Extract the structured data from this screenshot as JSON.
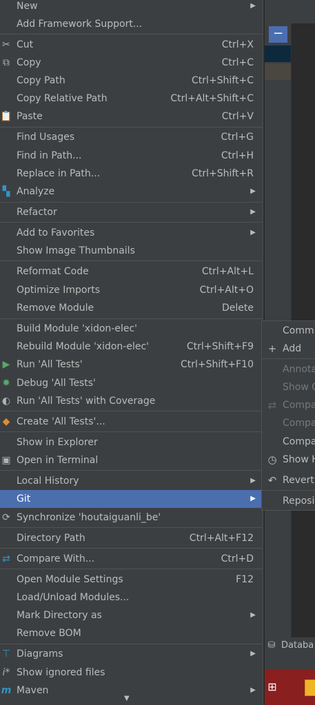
{
  "context_menu": {
    "items": [
      {
        "label": "New",
        "shortcut": "",
        "submenu": true,
        "icon": ""
      },
      {
        "label": "Add Framework Support...",
        "shortcut": "",
        "submenu": false,
        "icon": ""
      },
      {
        "label": "Cut",
        "shortcut": "Ctrl+X",
        "submenu": false,
        "icon": "scissors-icon"
      },
      {
        "label": "Copy",
        "shortcut": "Ctrl+C",
        "submenu": false,
        "icon": "copy-icon"
      },
      {
        "label": "Copy Path",
        "shortcut": "Ctrl+Shift+C",
        "submenu": false,
        "icon": ""
      },
      {
        "label": "Copy Relative Path",
        "shortcut": "Ctrl+Alt+Shift+C",
        "submenu": false,
        "icon": ""
      },
      {
        "label": "Paste",
        "shortcut": "Ctrl+V",
        "submenu": false,
        "icon": "clipboard-icon"
      },
      {
        "label": "Find Usages",
        "shortcut": "Ctrl+G",
        "submenu": false,
        "icon": ""
      },
      {
        "label": "Find in Path...",
        "shortcut": "Ctrl+H",
        "submenu": false,
        "icon": ""
      },
      {
        "label": "Replace in Path...",
        "shortcut": "Ctrl+Shift+R",
        "submenu": false,
        "icon": ""
      },
      {
        "label": "Analyze",
        "shortcut": "",
        "submenu": true,
        "icon": "analyze-icon"
      },
      {
        "label": "Refactor",
        "shortcut": "",
        "submenu": true,
        "icon": ""
      },
      {
        "label": "Add to Favorites",
        "shortcut": "",
        "submenu": true,
        "icon": ""
      },
      {
        "label": "Show Image Thumbnails",
        "shortcut": "",
        "submenu": false,
        "icon": ""
      },
      {
        "label": "Reformat Code",
        "shortcut": "Ctrl+Alt+L",
        "submenu": false,
        "icon": ""
      },
      {
        "label": "Optimize Imports",
        "shortcut": "Ctrl+Alt+O",
        "submenu": false,
        "icon": ""
      },
      {
        "label": "Remove Module",
        "shortcut": "Delete",
        "submenu": false,
        "icon": ""
      },
      {
        "label": "Build Module 'xidon-elec'",
        "shortcut": "",
        "submenu": false,
        "icon": ""
      },
      {
        "label": "Rebuild Module 'xidon-elec'",
        "shortcut": "Ctrl+Shift+F9",
        "submenu": false,
        "icon": ""
      },
      {
        "label": "Run 'All Tests'",
        "shortcut": "Ctrl+Shift+F10",
        "submenu": false,
        "icon": "run-icon"
      },
      {
        "label": "Debug 'All Tests'",
        "shortcut": "",
        "submenu": false,
        "icon": "debug-icon"
      },
      {
        "label": "Run 'All Tests' with Coverage",
        "shortcut": "",
        "submenu": false,
        "icon": "coverage-icon"
      },
      {
        "label": "Create 'All Tests'...",
        "shortcut": "",
        "submenu": false,
        "icon": "create-test-icon"
      },
      {
        "label": "Show in Explorer",
        "shortcut": "",
        "submenu": false,
        "icon": ""
      },
      {
        "label": "Open in Terminal",
        "shortcut": "",
        "submenu": false,
        "icon": "terminal-icon"
      },
      {
        "label": "Local History",
        "shortcut": "",
        "submenu": true,
        "icon": ""
      },
      {
        "label": "Git",
        "shortcut": "",
        "submenu": true,
        "icon": "",
        "selected": true
      },
      {
        "label": "Synchronize 'houtaiguanli_be'",
        "shortcut": "",
        "submenu": false,
        "icon": "sync-icon"
      },
      {
        "label": "Directory Path",
        "shortcut": "Ctrl+Alt+F12",
        "submenu": false,
        "icon": ""
      },
      {
        "label": "Compare With...",
        "shortcut": "Ctrl+D",
        "submenu": false,
        "icon": "compare-icon"
      },
      {
        "label": "Open Module Settings",
        "shortcut": "F12",
        "submenu": false,
        "icon": ""
      },
      {
        "label": "Load/Unload Modules...",
        "shortcut": "",
        "submenu": false,
        "icon": ""
      },
      {
        "label": "Mark Directory as",
        "shortcut": "",
        "submenu": true,
        "icon": ""
      },
      {
        "label": "Remove BOM",
        "shortcut": "",
        "submenu": false,
        "icon": ""
      },
      {
        "label": "Diagrams",
        "shortcut": "",
        "submenu": true,
        "icon": "diagrams-icon"
      },
      {
        "label": "Show ignored files",
        "shortcut": "",
        "submenu": false,
        "icon": "ignored-files-icon"
      },
      {
        "label": "Maven",
        "shortcut": "",
        "submenu": true,
        "icon": "maven-icon"
      }
    ]
  },
  "git_submenu": {
    "items": [
      {
        "label": "Commi",
        "disabled": false,
        "icon": ""
      },
      {
        "label": "Add",
        "disabled": false,
        "icon": "plus-icon"
      },
      {
        "label": "Annotat",
        "disabled": true,
        "icon": ""
      },
      {
        "label": "Show G",
        "disabled": true,
        "icon": ""
      },
      {
        "label": "Compa",
        "disabled": true,
        "icon": "compare-icon"
      },
      {
        "label": "Compa",
        "disabled": true,
        "icon": ""
      },
      {
        "label": "Compa",
        "disabled": false,
        "icon": ""
      },
      {
        "label": "Show H",
        "disabled": false,
        "icon": "clock-icon"
      },
      {
        "label": "Revert.",
        "disabled": false,
        "icon": "revert-icon"
      },
      {
        "label": "Reposit",
        "disabled": false,
        "icon": ""
      }
    ]
  },
  "background": {
    "bottom_tab_label": "Databa",
    "collapse_glyph": "−"
  },
  "colors": {
    "menu_bg": "#3c3f41",
    "selection": "#4b6eaf",
    "text": "#bbbbbb",
    "disabled_text": "#777777",
    "separator": "#515151"
  }
}
